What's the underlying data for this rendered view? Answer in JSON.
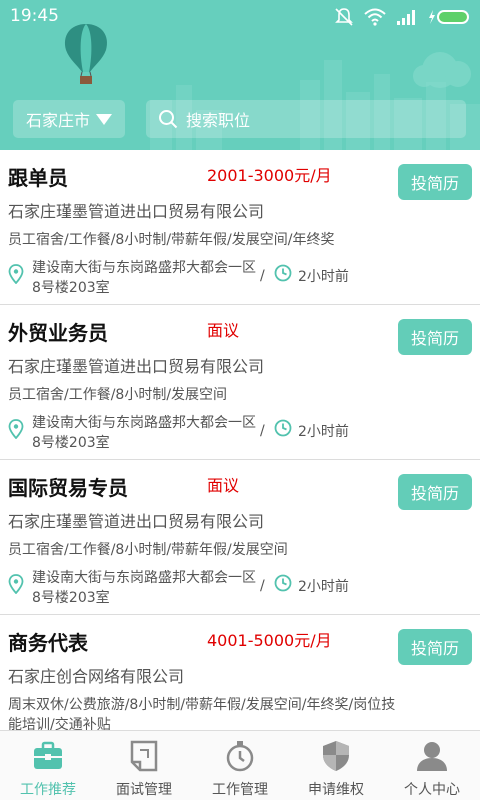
{
  "status": {
    "time": "19:45"
  },
  "header": {
    "city": "石家庄市",
    "search_placeholder": "搜索职位"
  },
  "colors": {
    "accent": "#66cfbd",
    "salary": "#e00000",
    "button": "#63cdb8",
    "active_tab": "#52c2ae"
  },
  "jobs": [
    {
      "title": "跟单员",
      "salary": "2001-3000元/月",
      "apply_label": "投简历",
      "company": "石家庄瑾墨管道进出口贸易有限公司",
      "benefits": "员工宿舍/工作餐/8小时制/带薪年假/发展空间/年终奖",
      "address": "建设南大街与东岗路盛邦大都会一区8号楼203室",
      "separator": "/",
      "time_ago": "2小时前"
    },
    {
      "title": "外贸业务员",
      "salary": "面议",
      "apply_label": "投简历",
      "company": "石家庄瑾墨管道进出口贸易有限公司",
      "benefits": "员工宿舍/工作餐/8小时制/发展空间",
      "address": "建设南大街与东岗路盛邦大都会一区8号楼203室",
      "separator": "/",
      "time_ago": "2小时前"
    },
    {
      "title": "国际贸易专员",
      "salary": "面议",
      "apply_label": "投简历",
      "company": "石家庄瑾墨管道进出口贸易有限公司",
      "benefits": "员工宿舍/工作餐/8小时制/带薪年假/发展空间",
      "address": "建设南大街与东岗路盛邦大都会一区8号楼203室",
      "separator": "/",
      "time_ago": "2小时前"
    },
    {
      "title": "商务代表",
      "salary": "4001-5000元/月",
      "apply_label": "投简历",
      "company": "石家庄创合网络有限公司",
      "benefits": "周末双休/公费旅游/8小时制/带薪年假/发展空间/年终奖/岗位技能培训/交通补贴"
    }
  ],
  "nav": [
    {
      "label": "工作推荐",
      "icon": "briefcase-icon",
      "active": true
    },
    {
      "label": "面试管理",
      "icon": "document-icon",
      "active": false
    },
    {
      "label": "工作管理",
      "icon": "stopwatch-icon",
      "active": false
    },
    {
      "label": "申请维权",
      "icon": "shield-icon",
      "active": false
    },
    {
      "label": "个人中心",
      "icon": "user-icon",
      "active": false
    }
  ]
}
